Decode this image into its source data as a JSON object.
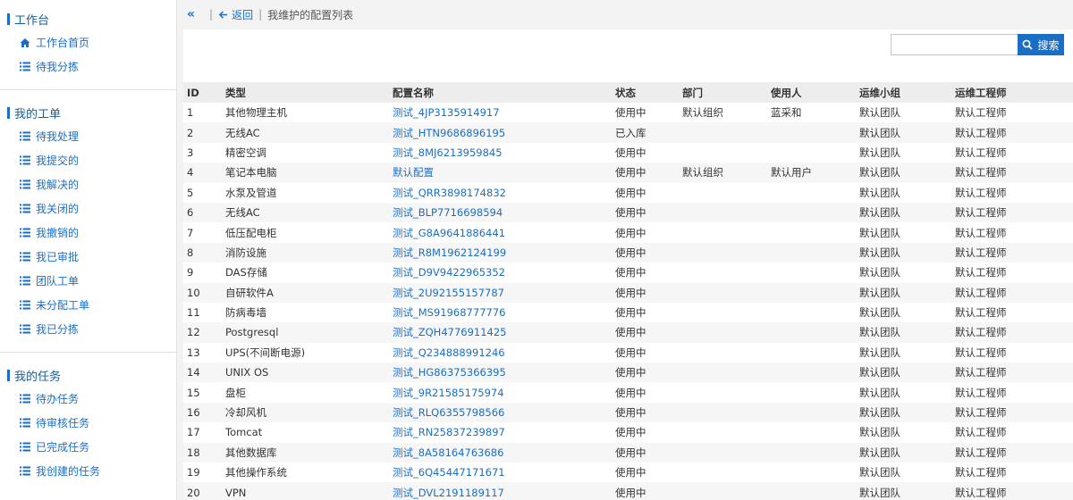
{
  "sidebar": {
    "groups": [
      {
        "title": "工作台",
        "items": [
          {
            "label": "工作台首页",
            "icon": "home-icon"
          },
          {
            "label": "待我分拣",
            "icon": "list-icon"
          }
        ]
      },
      {
        "title": "我的工单",
        "items": [
          {
            "label": "待我处理"
          },
          {
            "label": "我提交的"
          },
          {
            "label": "我解决的"
          },
          {
            "label": "我关闭的"
          },
          {
            "label": "我撤销的"
          },
          {
            "label": "我已审批"
          },
          {
            "label": "团队工单"
          },
          {
            "label": "未分配工单"
          },
          {
            "label": "我已分拣"
          }
        ]
      },
      {
        "title": "我的任务",
        "items": [
          {
            "label": "待办任务"
          },
          {
            "label": "待审核任务"
          },
          {
            "label": "已完成任务"
          },
          {
            "label": "我创建的任务"
          }
        ]
      }
    ]
  },
  "topbar": {
    "collapse": "«",
    "back_label": "返回",
    "breadcrumb": "我维护的配置列表"
  },
  "search": {
    "value": "",
    "placeholder": "",
    "button_label": "搜索"
  },
  "colors": {
    "accent": "#1a6fc4",
    "header_bg": "#ededed",
    "row_alt": "#f6f6f6"
  },
  "table": {
    "headers": [
      "ID",
      "类型",
      "配置名称",
      "状态",
      "部门",
      "使用人",
      "运维小组",
      "运维工程师"
    ],
    "rows": [
      [
        "1",
        "其他物理主机",
        "测试_4JP3135914917",
        "使用中",
        "默认组织",
        "蓝采和",
        "默认团队",
        "默认工程师"
      ],
      [
        "2",
        "无线AC",
        "测试_HTN9686896195",
        "已入库",
        "",
        "",
        "默认团队",
        "默认工程师"
      ],
      [
        "3",
        "精密空调",
        "测试_8MJ6213959845",
        "使用中",
        "",
        "",
        "默认团队",
        "默认工程师"
      ],
      [
        "4",
        "笔记本电脑",
        "默认配置",
        "使用中",
        "默认组织",
        "默认用户",
        "默认团队",
        "默认工程师"
      ],
      [
        "5",
        "水泵及管道",
        "测试_QRR3898174832",
        "使用中",
        "",
        "",
        "默认团队",
        "默认工程师"
      ],
      [
        "6",
        "无线AC",
        "测试_BLP7716698594",
        "使用中",
        "",
        "",
        "默认团队",
        "默认工程师"
      ],
      [
        "7",
        "低压配电柜",
        "测试_G8A9641886441",
        "使用中",
        "",
        "",
        "默认团队",
        "默认工程师"
      ],
      [
        "8",
        "消防设施",
        "测试_R8M1962124199",
        "使用中",
        "",
        "",
        "默认团队",
        "默认工程师"
      ],
      [
        "9",
        "DAS存储",
        "测试_D9V9422965352",
        "使用中",
        "",
        "",
        "默认团队",
        "默认工程师"
      ],
      [
        "10",
        "自研软件A",
        "测试_2U92155157787",
        "使用中",
        "",
        "",
        "默认团队",
        "默认工程师"
      ],
      [
        "11",
        "防病毒墙",
        "测试_MS91968777776",
        "使用中",
        "",
        "",
        "默认团队",
        "默认工程师"
      ],
      [
        "12",
        "Postgresql",
        "测试_ZQH4776911425",
        "使用中",
        "",
        "",
        "默认团队",
        "默认工程师"
      ],
      [
        "13",
        "UPS(不间断电源)",
        "测试_Q234888991246",
        "使用中",
        "",
        "",
        "默认团队",
        "默认工程师"
      ],
      [
        "14",
        "UNIX OS",
        "测试_HG86375366395",
        "使用中",
        "",
        "",
        "默认团队",
        "默认工程师"
      ],
      [
        "15",
        "盘柜",
        "测试_9R21585175974",
        "使用中",
        "",
        "",
        "默认团队",
        "默认工程师"
      ],
      [
        "16",
        "冷却风机",
        "测试_RLQ6355798566",
        "使用中",
        "",
        "",
        "默认团队",
        "默认工程师"
      ],
      [
        "17",
        "Tomcat",
        "测试_RN25837239897",
        "使用中",
        "",
        "",
        "默认团队",
        "默认工程师"
      ],
      [
        "18",
        "其他数据库",
        "测试_8A58164763686",
        "使用中",
        "",
        "",
        "默认团队",
        "默认工程师"
      ],
      [
        "19",
        "其他操作系统",
        "测试_6Q45447171671",
        "使用中",
        "",
        "",
        "默认团队",
        "默认工程师"
      ],
      [
        "20",
        "VPN",
        "测试_DVL2191189117",
        "使用中",
        "",
        "",
        "默认团队",
        "默认工程师"
      ]
    ]
  }
}
